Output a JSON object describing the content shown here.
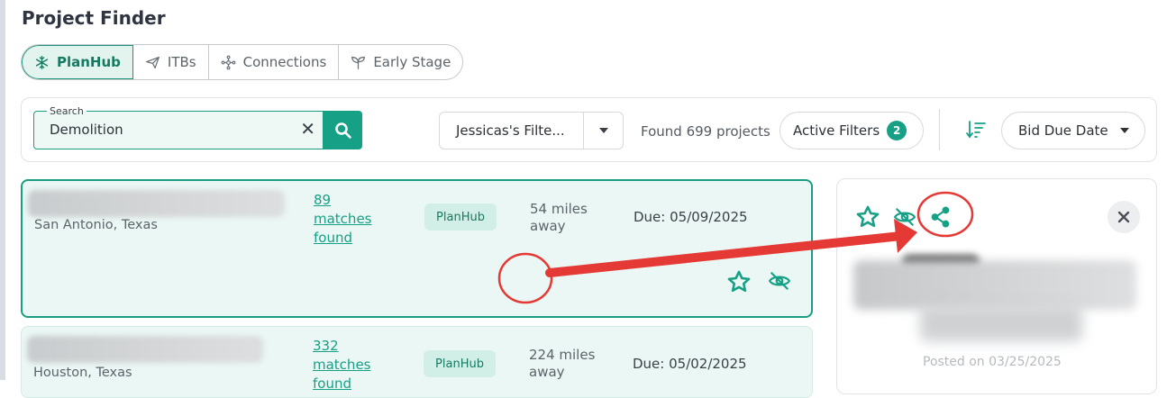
{
  "page": {
    "title": "Project Finder"
  },
  "tabs": [
    {
      "label": "PlanHub",
      "active": true,
      "icon": "snowflake-icon"
    },
    {
      "label": "ITBs",
      "active": false,
      "icon": "paper-plane-icon"
    },
    {
      "label": "Connections",
      "active": false,
      "icon": "network-icon"
    },
    {
      "label": "Early Stage",
      "active": false,
      "icon": "sprout-icon"
    }
  ],
  "search": {
    "label": "Search",
    "value": "Demolition",
    "clear_glyph": "✕"
  },
  "filters": {
    "saved_filter": "Jessicas's Filte...",
    "found_text": "Found 699 projects",
    "active_label": "Active Filters",
    "active_count": "2"
  },
  "sort": {
    "value": "Bid Due Date"
  },
  "projects": [
    {
      "location": "San Antonio, Texas",
      "matches": [
        "89",
        "matches",
        "found"
      ],
      "source": "PlanHub",
      "distance": [
        "54 miles",
        "away"
      ],
      "due": "Due: 05/09/2025"
    },
    {
      "location": "Houston, Texas",
      "matches": [
        "332",
        "matches",
        "found"
      ],
      "source": "PlanHub",
      "distance": [
        "224 miles",
        "away"
      ],
      "due": "Due: 05/02/2025"
    }
  ],
  "detail": {
    "posted": "Posted on 03/25/2025"
  },
  "colors": {
    "accent": "#16a085",
    "card_bg": "#ebf7f4",
    "annotation": "#e53935"
  }
}
